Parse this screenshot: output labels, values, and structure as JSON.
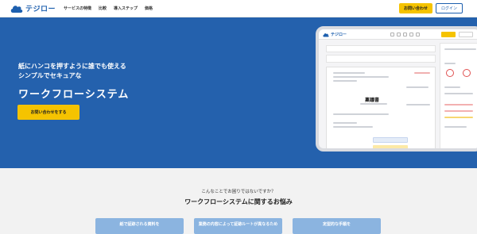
{
  "header": {
    "logo_text": "テジロー",
    "nav": [
      "サービスの特徴",
      "比較",
      "導入ステップ",
      "価格"
    ],
    "contact_label": "お問い合わせ",
    "login_label": "ログイン"
  },
  "hero": {
    "subtitle": "紙にハンコを押すように誰でも使える\nシンプルでセキュアな",
    "title": "ワークフローシステム",
    "cta_label": "お問い合わせをする"
  },
  "app_preview": {
    "logo_text": "テジロー",
    "document_title": "稟議書"
  },
  "problems": {
    "subtitle": "こんなことでお困りではないですか？",
    "title": "ワークフローシステムに関するお悩み",
    "cards": [
      {
        "label": "紙で証跡される資料を"
      },
      {
        "label": "業務の内容によって証跡ルートが異なるため"
      },
      {
        "label": "定型的な手順を"
      }
    ]
  },
  "colors": {
    "brand_blue": "#2461ad",
    "accent_yellow": "#f5c300"
  }
}
